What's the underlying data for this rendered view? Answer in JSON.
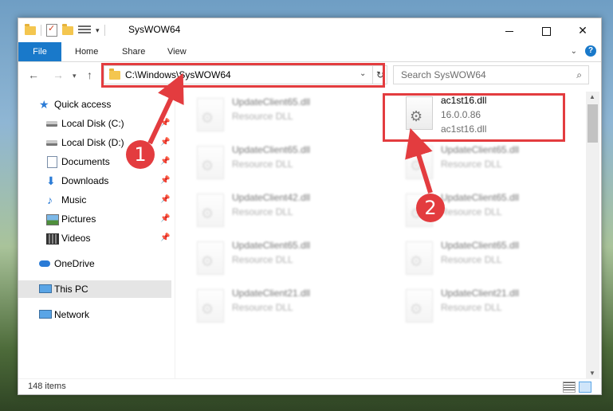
{
  "window": {
    "title": "SysWOW64"
  },
  "ribbon": {
    "file": "File",
    "home": "Home",
    "share": "Share",
    "view": "View"
  },
  "address": {
    "path": "C:\\Windows\\SysWOW64"
  },
  "search": {
    "placeholder": "Search SysWOW64"
  },
  "sidebar": {
    "quick_access": "Quick access",
    "items": [
      "Local Disk (C:)",
      "Local Disk (D:)",
      "Documents",
      "Downloads",
      "Music",
      "Pictures",
      "Videos"
    ],
    "onedrive": "OneDrive",
    "this_pc": "This PC",
    "network": "Network"
  },
  "files": {
    "left": [
      {
        "name": "UpdateClient65.dll",
        "type": "Resource DLL"
      },
      {
        "name": "UpdateClient65.dll",
        "type": "Resource DLL"
      },
      {
        "name": "UpdateClient42.dll",
        "type": "Resource DLL"
      },
      {
        "name": "UpdateClient65.dll",
        "type": "Resource DLL"
      },
      {
        "name": "UpdateClient21.dll",
        "type": "Resource DLL"
      }
    ],
    "highlighted": {
      "name": "ac1st16.dll",
      "version": "16.0.0.86",
      "desc": "ac1st16.dll"
    },
    "right": [
      {
        "name": "UpdateClient65.dll",
        "type": "Resource DLL"
      },
      {
        "name": "UpdateClient65.dll",
        "type": "Resource DLL"
      },
      {
        "name": "UpdateClient65.dll",
        "type": "Resource DLL"
      },
      {
        "name": "UpdateClient21.dll",
        "type": "Resource DLL"
      }
    ]
  },
  "status": {
    "count": "148 items"
  },
  "annotations": {
    "step1": "1",
    "step2": "2",
    "color": "#e33c3f"
  }
}
